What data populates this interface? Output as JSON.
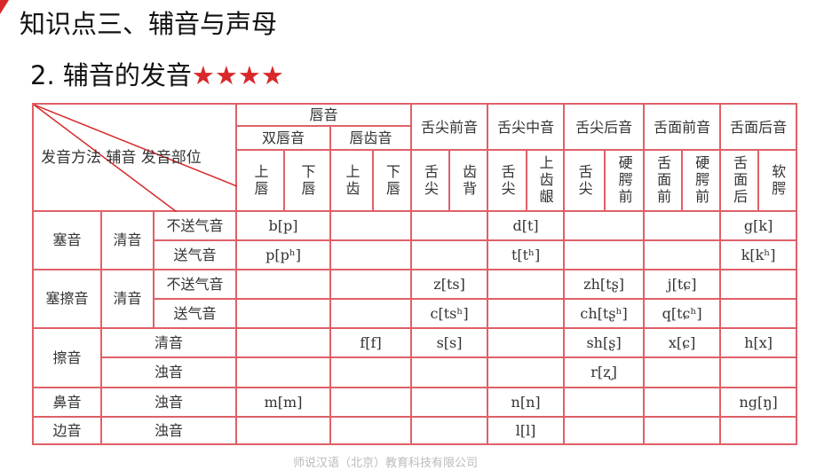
{
  "title": "知识点三、辅音与声母",
  "subtitle": "2. 辅音的发音",
  "stars": "★★★★",
  "diag_label": "发音方法  辅音  发音部位",
  "groups": [
    "唇音",
    "舌尖前音",
    "舌尖中音",
    "舌尖后音",
    "舌面前音",
    "舌面后音"
  ],
  "subgroups": [
    "双唇音",
    "唇齿音"
  ],
  "subcols": [
    "上唇",
    "下唇",
    "上齿",
    "下唇",
    "舌尖",
    "齿背",
    "舌尖",
    "上齿龈",
    "舌尖",
    "硬腭前",
    "舌面前",
    "硬腭前",
    "舌面后",
    "软腭"
  ],
  "rows": [
    {
      "method": "塞音",
      "voice": "清音",
      "asp": "不送气音",
      "cells": [
        "b[p]",
        "",
        "",
        "d[t]",
        "",
        "",
        "g[k]"
      ]
    },
    {
      "asp": "送气音",
      "cells": [
        "p[pʰ]",
        "",
        "",
        "t[tʰ]",
        "",
        "",
        "k[kʰ]"
      ]
    },
    {
      "method": "塞擦音",
      "voice": "清音",
      "asp": "不送气音",
      "cells": [
        "",
        "",
        "z[ts]",
        "",
        "zh[tʂ]",
        "j[tɕ]",
        ""
      ]
    },
    {
      "asp": "送气音",
      "cells": [
        "",
        "",
        "c[tsʰ]",
        "",
        "ch[tʂʰ]",
        "q[tɕʰ]",
        ""
      ]
    },
    {
      "method": "擦音",
      "voice": "清音",
      "cells": [
        "",
        "f[f]",
        "s[s]",
        "",
        "sh[ʂ]",
        "x[ɕ]",
        "h[x]"
      ]
    },
    {
      "voice": "浊音",
      "cells": [
        "",
        "",
        "",
        "",
        "r[ʐ]",
        "",
        ""
      ]
    },
    {
      "method": "鼻音",
      "voice": "浊音",
      "cells": [
        "m[m]",
        "",
        "",
        "n[n]",
        "",
        "",
        "ng[ŋ]"
      ]
    },
    {
      "method": "边音",
      "voice": "浊音",
      "cells": [
        "",
        "",
        "",
        "l[l]",
        "",
        "",
        ""
      ]
    }
  ],
  "footer": "师说汉语（北京）教育科技有限公司"
}
